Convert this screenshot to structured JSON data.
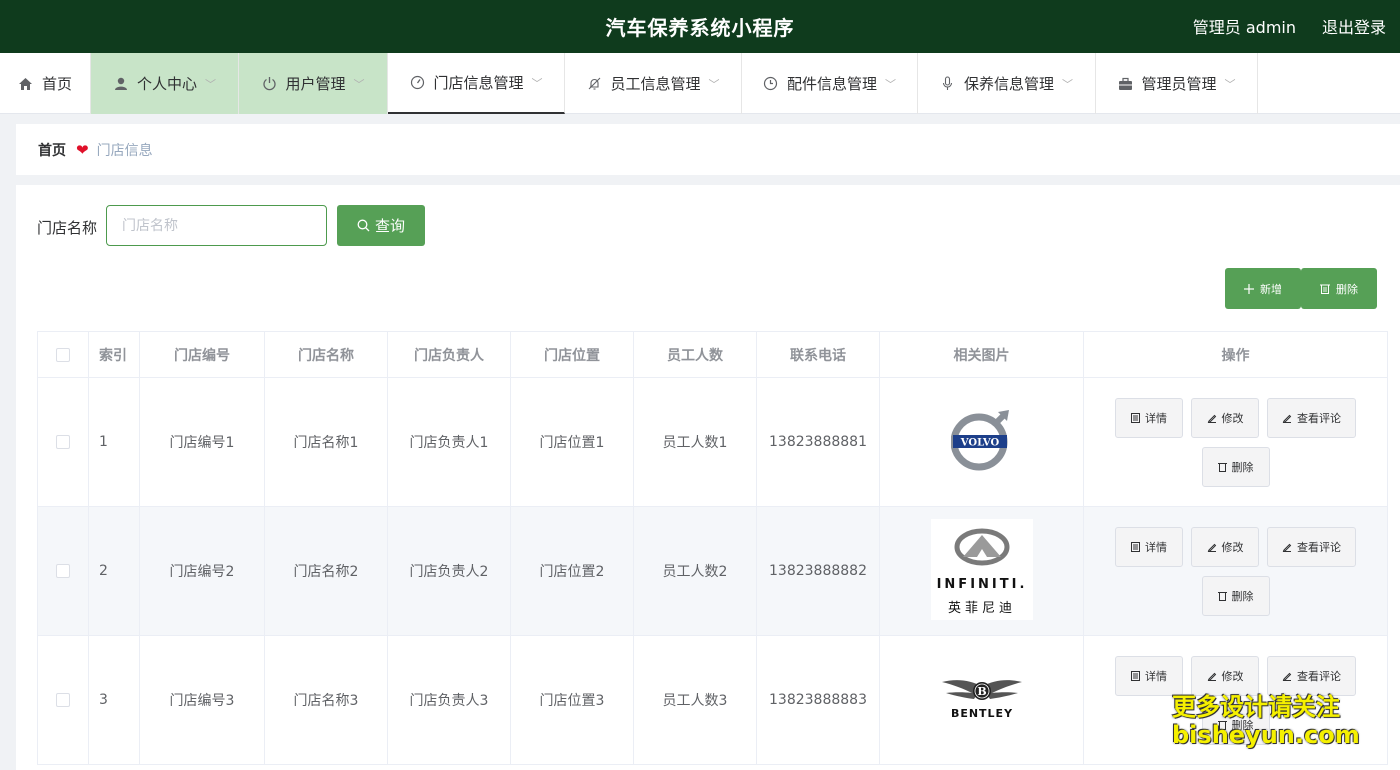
{
  "header": {
    "title": "汽车保养系统小程序",
    "user": "管理员 admin",
    "logout": "退出登录"
  },
  "nav": [
    {
      "label": "首页",
      "icon": "home-icon"
    },
    {
      "label": "个人中心",
      "icon": "user-icon"
    },
    {
      "label": "用户管理",
      "icon": "power-icon"
    },
    {
      "label": "门店信息管理",
      "icon": "gauge-icon"
    },
    {
      "label": "员工信息管理",
      "icon": "bell-off-icon"
    },
    {
      "label": "配件信息管理",
      "icon": "clock-icon"
    },
    {
      "label": "保养信息管理",
      "icon": "microphone-icon"
    },
    {
      "label": "管理员管理",
      "icon": "briefcase-icon"
    }
  ],
  "breadcrumb": {
    "home": "首页",
    "current": "门店信息"
  },
  "search": {
    "label": "门店名称",
    "placeholder": "门店名称",
    "button": "查询"
  },
  "actions": {
    "add": "新增",
    "delete": "删除"
  },
  "table": {
    "columns": [
      "索引",
      "门店编号",
      "门店名称",
      "门店负责人",
      "门店位置",
      "员工人数",
      "联系电话",
      "相关图片",
      "操作"
    ],
    "rows": [
      {
        "index": "1",
        "code": "门店编号1",
        "name": "门店名称1",
        "manager": "门店负责人1",
        "location": "门店位置1",
        "staff": "员工人数1",
        "phone": "13823888881",
        "logo": "volvo-logo",
        "logo_text": "VOLVO"
      },
      {
        "index": "2",
        "code": "门店编号2",
        "name": "门店名称2",
        "manager": "门店负责人2",
        "location": "门店位置2",
        "staff": "员工人数2",
        "phone": "13823888882",
        "logo": "infiniti-logo",
        "logo_text": "INFINITI.",
        "logo_sub": "英菲尼迪"
      },
      {
        "index": "3",
        "code": "门店编号3",
        "name": "门店名称3",
        "manager": "门店负责人3",
        "location": "门店位置3",
        "staff": "员工人数3",
        "phone": "13823888883",
        "logo": "bentley-logo",
        "logo_text": "BENTLEY"
      }
    ],
    "row_actions": {
      "detail": "详情",
      "edit": "修改",
      "review": "查看评论",
      "delete": "删除"
    }
  },
  "watermark": {
    "line1": "更多设计请关注",
    "line2": "bisheyun.com"
  }
}
